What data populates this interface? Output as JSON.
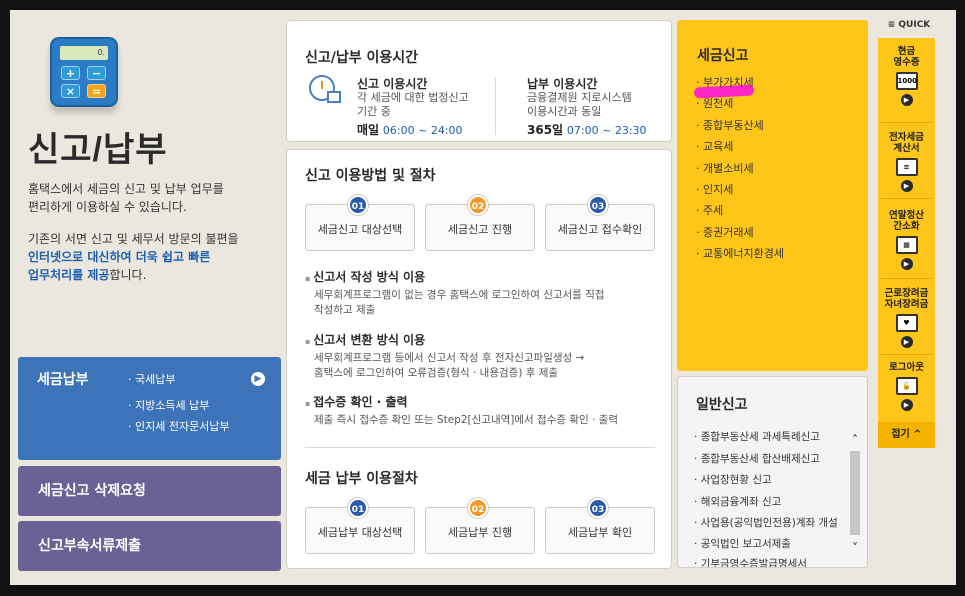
{
  "left": {
    "calc_display": "0.",
    "title": "신고/납부",
    "desc1": [
      "홈택스에서 세금의 신고 및 납부 업무를",
      "편리하게 이용하실 수 있습니다."
    ],
    "desc2_line1": "기존의 서면 신고 및 세무서 방문의 불편을",
    "desc2_line2_hl": "인터넷으로 대신하여 더욱 쉽고 빠른",
    "desc2_line3_hl": "업무처리를 제공",
    "desc2_line3_tail": "합니다.",
    "pay": {
      "title": "세금납부",
      "items": [
        "· 국세납부",
        "· 지방소득세 납부",
        "· 인지세 전자문서납부"
      ]
    },
    "buttons": [
      "세금신고 삭제요청",
      "신고부속서류제출"
    ]
  },
  "time": {
    "title": "신고/납부 이용시간",
    "report": {
      "head": "신고 이용시간",
      "text1": "각 세금에 대한 법정신고",
      "text2": "기간 중",
      "day": "매일",
      "hours": "06:00 ~ 24:00"
    },
    "pay": {
      "head": "납부 이용시간",
      "text1": "금융결제원 지로시스템",
      "text2": "이용시간과 동일",
      "day": "365일",
      "hours": "07:00 ~ 23:30"
    }
  },
  "proc": {
    "title1": "신고 이용방법 및 절차",
    "steps1": [
      {
        "num": "01",
        "label": "세금신고 대상선택"
      },
      {
        "num": "02",
        "label": "세금신고 진행"
      },
      {
        "num": "03",
        "label": "세금신고 접수확인"
      }
    ],
    "methods": [
      {
        "head": "신고서 작성 방식 이용",
        "line1": "세무회계프로그램이 없는 경우 홈택스에 로그인하여 신고서를 직접",
        "line2": "작성하고 제출"
      },
      {
        "head": "신고서 변환 방식 이용",
        "line1": "세무회계프로그램 등에서 신고서 작성 후 전자신고파일생성 →",
        "line2": "홈택스에 로그인하여 오류검증(형식 · 내용검증) 후 제출"
      },
      {
        "head": "접수증 확인 · 출력",
        "line1": "제출 즉시 접수증 확인 또는 Step2[신고내역]에서 접수증 확인 · 출력",
        "line2": ""
      }
    ],
    "title2": "세금 납부 이용절차",
    "steps2": [
      {
        "num": "01",
        "label": "세금납부 대상선택"
      },
      {
        "num": "02",
        "label": "세금납부 진행"
      },
      {
        "num": "03",
        "label": "세금납부 확인"
      }
    ]
  },
  "tax": {
    "title": "세금신고",
    "items": [
      "부가가치세",
      "원천세",
      "종합부동산세",
      "교육세",
      "개별소비세",
      "인지세",
      "주세",
      "증권거래세",
      "교통에너지환경세"
    ]
  },
  "general": {
    "title": "일반신고",
    "items": [
      "종합부동산세 과세특례신고",
      "종합부동산세 합산배제신고",
      "사업장현황 신고",
      "해외금융계좌 신고",
      "사업용(공익법인전용)계좌 개설",
      "공익법인 보고서제출",
      "기부금영수증발급명세서"
    ]
  },
  "quick": {
    "head": "≡ QUICK",
    "items": [
      {
        "label1": "현금",
        "label2": "영수증",
        "icon": "1000"
      },
      {
        "label1": "전자세금",
        "label2": "계산서",
        "icon": "≡"
      },
      {
        "label1": "연말정산",
        "label2": "간소화",
        "icon": "▦"
      },
      {
        "label1": "근로장려금",
        "label2": "자녀장려금",
        "icon": "♥"
      },
      {
        "label1": "로그아웃",
        "label2": "",
        "icon": "🔓"
      }
    ],
    "close": "접기 ^"
  }
}
